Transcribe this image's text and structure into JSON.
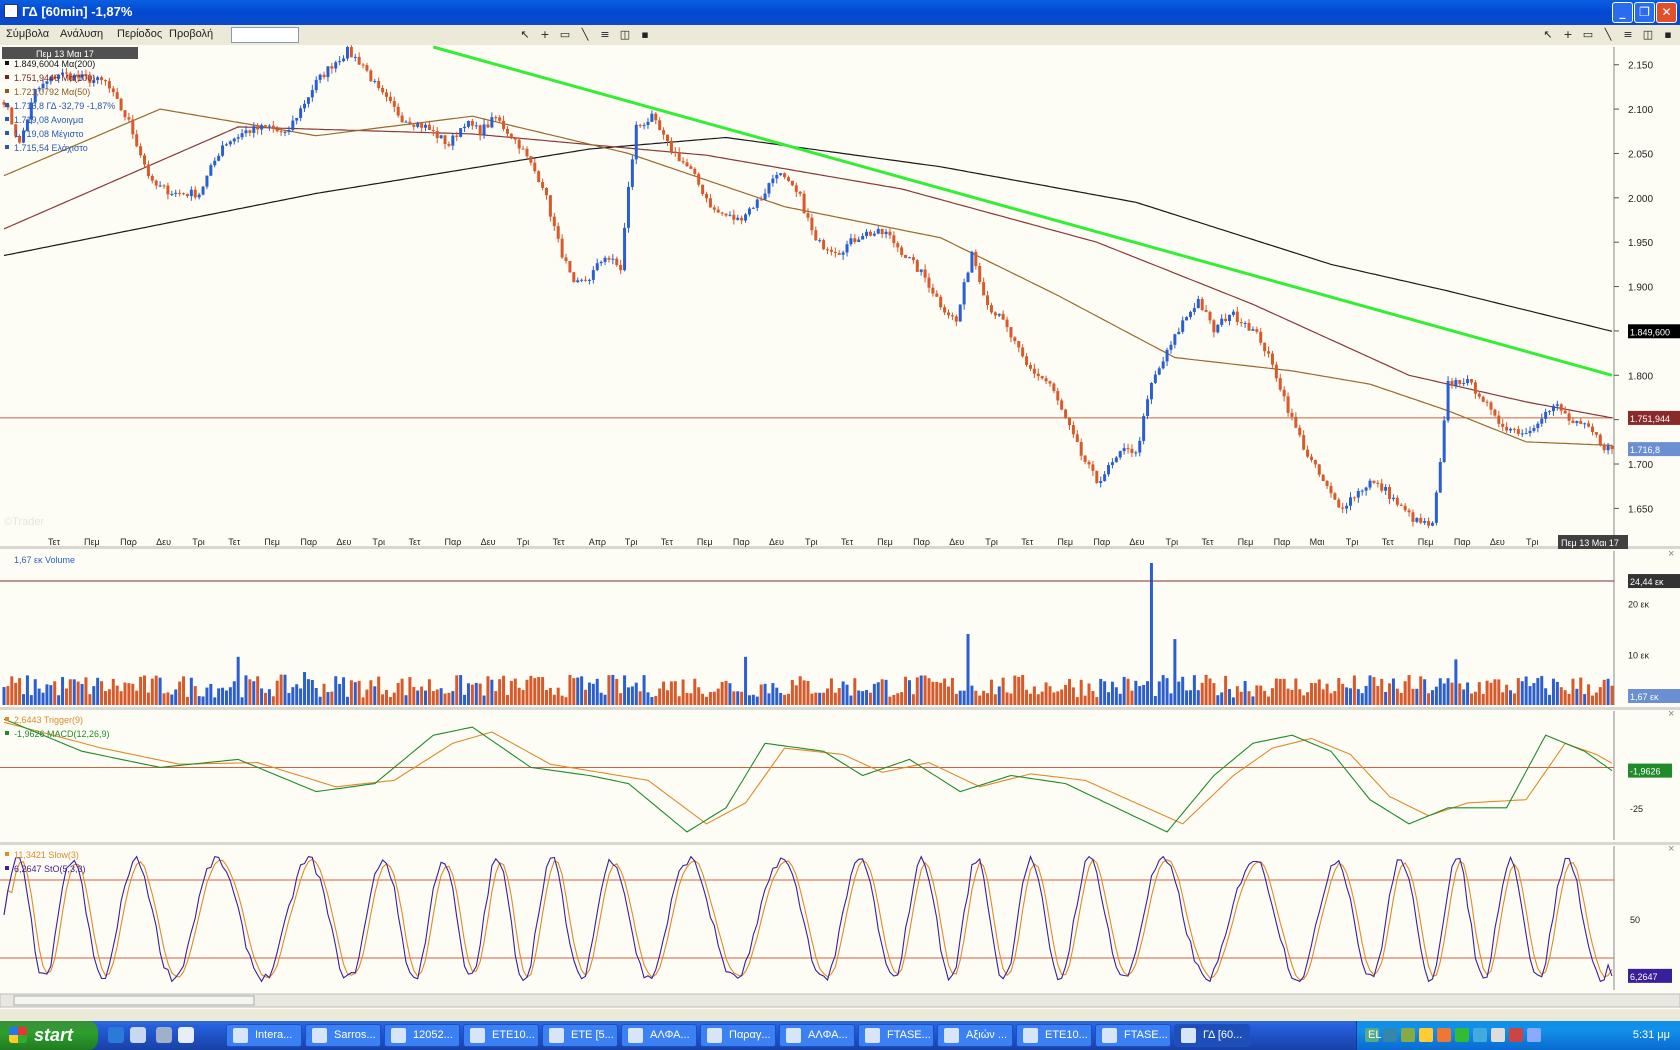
{
  "window": {
    "title": "ΓΔ [60min] -1,87%",
    "min_label": "_",
    "max_label": "❐",
    "close_label": "✕"
  },
  "menu": {
    "items": [
      "Σύμβολα",
      "Ανάλυση",
      "Περίοδος",
      "Προβολή"
    ],
    "symbol_placeholder": ""
  },
  "toolbar": {
    "left_icons": [
      "pointer-icon",
      "crosshair-icon",
      "rectangle-icon",
      "line-icon",
      "lines-icon",
      "chart-icon",
      "save-icon"
    ],
    "right_icons": [
      "pointer-icon",
      "crosshair-icon",
      "rectangle-icon",
      "line-icon",
      "lines-icon",
      "chart-icon",
      "save-icon"
    ]
  },
  "price_panel": {
    "date_header": "Πεμ 13 Μαι 17",
    "legend": [
      {
        "text": "1.849,6004 Μα(200)",
        "color": "#111111"
      },
      {
        "text": "1.751,9446 Μα(100)",
        "color": "#7a1f1f"
      },
      {
        "text": "1.721,0792 Μα(50)",
        "color": "#8b5a1a"
      },
      {
        "text": "1.716,8 ΓΔ -32,79 -1,87%",
        "color": "#2858b0"
      },
      {
        "text": "1.719,08 Ανοιγμα",
        "color": "#2858b0"
      },
      {
        "text": "1.719,08 Μέγιστο",
        "color": "#2858b0"
      },
      {
        "text": "1.715,54 Ελάχιστο",
        "color": "#2858b0"
      }
    ],
    "y_ticks": [
      "2.150",
      "2.100",
      "2.050",
      "2.000",
      "1.950",
      "1.900",
      "1.850",
      "1.800",
      "1.750",
      "1.700",
      "1.650"
    ],
    "badges": {
      "ma200": "1.849,600",
      "ma100": "1.751,944",
      "price": "1.716,8"
    },
    "watermark": "©Trader",
    "x_ticks": [
      "Τετ",
      "Πεμ",
      "Παρ",
      "Δευ",
      "Τρι",
      "Τετ",
      "Πεμ",
      "Παρ",
      "Δευ",
      "Τρι",
      "Τετ",
      "Παρ",
      "Δευ",
      "Τρι",
      "Τετ",
      "Απρ",
      "Τρι",
      "Τετ",
      "Πεμ",
      "Παρ",
      "Δευ",
      "Τρι",
      "Τετ",
      "Πεμ",
      "Παρ",
      "Δευ",
      "Τρι",
      "Τετ",
      "Πεμ",
      "Παρ",
      "Δευ",
      "Τρι",
      "Τετ",
      "Πεμ",
      "Παρ",
      "Μαι",
      "Τρι",
      "Τετ",
      "Πεμ",
      "Παρ",
      "Δευ",
      "Τρι",
      "Τετ"
    ],
    "x_cursor_label": "Πεμ 13 Μαι 17"
  },
  "volume_panel": {
    "legend": "1,67 εκ Volume",
    "y_ticks": [
      "20 εκ",
      "10 εκ"
    ],
    "badges": {
      "ref": "24,44 εκ",
      "last": "1,67 εκ"
    }
  },
  "macd_panel": {
    "legend_trigger": "2,6443 Trigger(9)",
    "legend_macd": "-1,9626 MACD(12,26,9)",
    "y_ticks": [
      "-25"
    ],
    "badges": {
      "macd": "-1,9626"
    }
  },
  "stoch_panel": {
    "legend_slow": "11,3421 Slow(3)",
    "legend_sto": "6,2647 StO(5,3,3)",
    "y_ticks": [
      "50"
    ],
    "badges": {
      "sto": "6,2647"
    }
  },
  "colors": {
    "up": "#2b5fd0",
    "down": "#d8592a",
    "ma200": "#1a1a1a",
    "ma100": "#8a3838",
    "ma50": "#9a6a2a",
    "trend": "#33ee33",
    "hline": "#d06040",
    "macd": "#1f8a2a",
    "trigger": "#e08a2a",
    "sto": "#3a1f9a",
    "slow": "#e08a2a"
  },
  "taskbar": {
    "start_label": "start",
    "tasks": [
      {
        "label": "Intera...",
        "active": false
      },
      {
        "label": "Sarros...",
        "active": false
      },
      {
        "label": "12052...",
        "active": false
      },
      {
        "label": "ETE10...",
        "active": false
      },
      {
        "label": "ETE [5...",
        "active": false
      },
      {
        "label": "ΑΛΦΑ...",
        "active": false
      },
      {
        "label": "Παραγ...",
        "active": false
      },
      {
        "label": "ΑΛΦΑ...",
        "active": false
      },
      {
        "label": "FTASE...",
        "active": false
      },
      {
        "label": "Αξιών ...",
        "active": false
      },
      {
        "label": "ETE10...",
        "active": false
      },
      {
        "label": "FTASE...",
        "active": false
      },
      {
        "label": "ΓΔ [60...",
        "active": true
      }
    ],
    "lang": "EL",
    "clock": "5:31 μμ"
  },
  "chart_data": [
    {
      "type": "candlestick",
      "title": "ΓΔ [60min]",
      "series": [
        {
          "name": "Μα(200)",
          "last": 1849.6004
        },
        {
          "name": "Μα(100)",
          "last": 1751.9446
        },
        {
          "name": "Μα(50)",
          "last": 1721.0792
        },
        {
          "name": "ΓΔ",
          "last": 1716.8
        }
      ],
      "ylim": [
        1620,
        2170
      ],
      "y_ticks": [
        2150,
        2100,
        2050,
        2000,
        1950,
        1900,
        1850,
        1800,
        1750,
        1700,
        1650
      ],
      "price_anchors": [
        [
          0,
          2110
        ],
        [
          4,
          2060
        ],
        [
          8,
          2120
        ],
        [
          14,
          2140
        ],
        [
          20,
          2135
        ],
        [
          26,
          2130
        ],
        [
          32,
          2085
        ],
        [
          38,
          2015
        ],
        [
          44,
          2005
        ],
        [
          50,
          2005
        ],
        [
          56,
          2060
        ],
        [
          62,
          2075
        ],
        [
          68,
          2080
        ],
        [
          72,
          2070
        ],
        [
          80,
          2130
        ],
        [
          84,
          2150
        ],
        [
          88,
          2165
        ],
        [
          92,
          2150
        ],
        [
          96,
          2120
        ],
        [
          102,
          2090
        ],
        [
          108,
          2080
        ],
        [
          114,
          2060
        ],
        [
          118,
          2085
        ],
        [
          122,
          2075
        ],
        [
          126,
          2090
        ],
        [
          132,
          2060
        ],
        [
          138,
          2015
        ],
        [
          142,
          1950
        ],
        [
          146,
          1900
        ],
        [
          150,
          1910
        ],
        [
          154,
          1935
        ],
        [
          158,
          1920
        ],
        [
          160,
          2010
        ],
        [
          162,
          2080
        ],
        [
          166,
          2090
        ],
        [
          170,
          2060
        ],
        [
          176,
          2030
        ],
        [
          182,
          1985
        ],
        [
          188,
          1975
        ],
        [
          194,
          2000
        ],
        [
          198,
          2030
        ],
        [
          204,
          2000
        ],
        [
          208,
          1950
        ],
        [
          214,
          1940
        ],
        [
          220,
          1960
        ],
        [
          226,
          1960
        ],
        [
          232,
          1930
        ],
        [
          236,
          1910
        ],
        [
          240,
          1880
        ],
        [
          244,
          1860
        ],
        [
          248,
          1940
        ],
        [
          252,
          1880
        ],
        [
          256,
          1860
        ],
        [
          262,
          1810
        ],
        [
          268,
          1790
        ],
        [
          272,
          1750
        ],
        [
          276,
          1710
        ],
        [
          280,
          1680
        ],
        [
          284,
          1700
        ],
        [
          288,
          1720
        ],
        [
          290,
          1710
        ],
        [
          294,
          1790
        ],
        [
          298,
          1825
        ],
        [
          302,
          1860
        ],
        [
          306,
          1885
        ],
        [
          310,
          1850
        ],
        [
          314,
          1870
        ],
        [
          318,
          1860
        ],
        [
          322,
          1840
        ],
        [
          326,
          1800
        ],
        [
          330,
          1750
        ],
        [
          334,
          1710
        ],
        [
          338,
          1680
        ],
        [
          342,
          1650
        ],
        [
          346,
          1665
        ],
        [
          350,
          1680
        ],
        [
          354,
          1670
        ],
        [
          358,
          1650
        ],
        [
          362,
          1635
        ],
        [
          366,
          1630
        ],
        [
          368,
          1700
        ],
        [
          370,
          1790
        ],
        [
          374,
          1795
        ],
        [
          378,
          1780
        ],
        [
          382,
          1750
        ],
        [
          386,
          1740
        ],
        [
          390,
          1735
        ],
        [
          394,
          1755
        ],
        [
          398,
          1765
        ],
        [
          402,
          1745
        ],
        [
          406,
          1740
        ],
        [
          410,
          1720
        ],
        [
          412,
          1716.8
        ]
      ],
      "ma200": [
        [
          0,
          1935
        ],
        [
          80,
          2005
        ],
        [
          150,
          2055
        ],
        [
          185,
          2068
        ],
        [
          240,
          2035
        ],
        [
          290,
          1995
        ],
        [
          340,
          1925
        ],
        [
          370,
          1895
        ],
        [
          412,
          1849.6
        ]
      ],
      "ma100": [
        [
          0,
          1965
        ],
        [
          60,
          2080
        ],
        [
          120,
          2072
        ],
        [
          180,
          2048
        ],
        [
          230,
          2010
        ],
        [
          280,
          1950
        ],
        [
          320,
          1880
        ],
        [
          360,
          1800
        ],
        [
          390,
          1770
        ],
        [
          412,
          1752
        ]
      ],
      "ma50": [
        [
          0,
          2025
        ],
        [
          40,
          2100
        ],
        [
          80,
          2070
        ],
        [
          120,
          2092
        ],
        [
          160,
          2050
        ],
        [
          200,
          1990
        ],
        [
          240,
          1955
        ],
        [
          270,
          1890
        ],
        [
          300,
          1820
        ],
        [
          330,
          1805
        ],
        [
          350,
          1790
        ],
        [
          370,
          1760
        ],
        [
          390,
          1725
        ],
        [
          412,
          1721
        ]
      ],
      "trendline": [
        [
          110,
          2170
        ],
        [
          412,
          1800
        ]
      ],
      "hline": 1752
    },
    {
      "type": "bar",
      "title": "Volume",
      "ylim": [
        0,
        28
      ],
      "y_ticks": [
        20,
        10
      ],
      "ref_line": 24.44,
      "last": 1.67,
      "spikes": [
        [
          60,
          9.5
        ],
        [
          77,
          6.5
        ],
        [
          190,
          9.5
        ],
        [
          247,
          14.0
        ],
        [
          253,
          5.0
        ],
        [
          294,
          28.0
        ],
        [
          300,
          13.0
        ],
        [
          372,
          9.0
        ]
      ]
    },
    {
      "type": "line",
      "title": "MACD(12,26,9)",
      "ylim": [
        -45,
        35
      ],
      "y_ticks": [
        -25
      ],
      "macd_last": -1.9626,
      "trigger_last": 2.6443,
      "macd_anchors": [
        [
          0,
          30
        ],
        [
          20,
          10
        ],
        [
          40,
          0
        ],
        [
          60,
          5
        ],
        [
          80,
          -15
        ],
        [
          95,
          -10
        ],
        [
          110,
          20
        ],
        [
          120,
          25
        ],
        [
          135,
          0
        ],
        [
          150,
          -5
        ],
        [
          160,
          -10
        ],
        [
          175,
          -40
        ],
        [
          185,
          -25
        ],
        [
          195,
          15
        ],
        [
          210,
          10
        ],
        [
          220,
          -5
        ],
        [
          232,
          5
        ],
        [
          245,
          -15
        ],
        [
          258,
          -5
        ],
        [
          272,
          -10
        ],
        [
          285,
          -25
        ],
        [
          298,
          -40
        ],
        [
          310,
          -5
        ],
        [
          320,
          15
        ],
        [
          330,
          20
        ],
        [
          340,
          10
        ],
        [
          350,
          -20
        ],
        [
          360,
          -35
        ],
        [
          370,
          -25
        ],
        [
          385,
          -25
        ],
        [
          395,
          20
        ],
        [
          405,
          10
        ],
        [
          412,
          -2
        ]
      ],
      "trigger_anchors": [
        [
          0,
          28
        ],
        [
          25,
          12
        ],
        [
          45,
          2
        ],
        [
          65,
          3
        ],
        [
          85,
          -12
        ],
        [
          100,
          -8
        ],
        [
          115,
          15
        ],
        [
          125,
          22
        ],
        [
          140,
          2
        ],
        [
          155,
          -4
        ],
        [
          165,
          -8
        ],
        [
          180,
          -35
        ],
        [
          190,
          -22
        ],
        [
          200,
          12
        ],
        [
          215,
          8
        ],
        [
          225,
          -3
        ],
        [
          237,
          3
        ],
        [
          250,
          -12
        ],
        [
          263,
          -4
        ],
        [
          277,
          -8
        ],
        [
          290,
          -22
        ],
        [
          302,
          -35
        ],
        [
          315,
          -5
        ],
        [
          325,
          12
        ],
        [
          335,
          18
        ],
        [
          345,
          8
        ],
        [
          355,
          -18
        ],
        [
          365,
          -30
        ],
        [
          375,
          -22
        ],
        [
          390,
          -20
        ],
        [
          400,
          15
        ],
        [
          408,
          8
        ],
        [
          412,
          2.6
        ]
      ]
    },
    {
      "type": "line",
      "title": "StO(5,3,3)",
      "ylim": [
        0,
        100
      ],
      "y_ticks": [
        50
      ],
      "levels": [
        80,
        20
      ],
      "sto_last": 6.2647,
      "slow_last": 11.3421
    }
  ]
}
